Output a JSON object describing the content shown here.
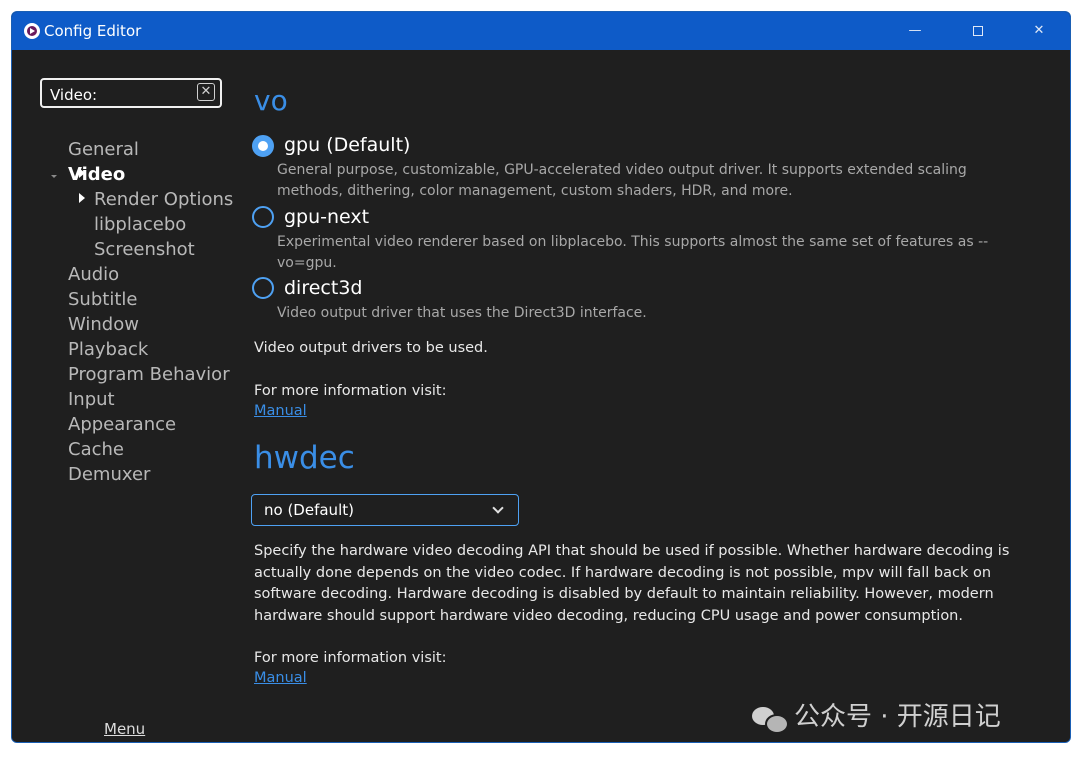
{
  "window": {
    "title": "Config Editor",
    "minimize_glyph": "—",
    "close_glyph": "✕"
  },
  "sidebar": {
    "search_value": "Video:",
    "clear_glyph": "✕",
    "items": [
      {
        "label": "General"
      },
      {
        "label": "Video"
      },
      {
        "label": "Render Options"
      },
      {
        "label": "libplacebo"
      },
      {
        "label": "Screenshot"
      },
      {
        "label": "Audio"
      },
      {
        "label": "Subtitle"
      },
      {
        "label": "Window"
      },
      {
        "label": "Playback"
      },
      {
        "label": "Program Behavior"
      },
      {
        "label": "Input"
      },
      {
        "label": "Appearance"
      },
      {
        "label": "Cache"
      },
      {
        "label": "Demuxer"
      }
    ],
    "menu_label": "Menu"
  },
  "vo": {
    "title": "vo",
    "options": [
      {
        "label": "gpu (Default)",
        "selected": true,
        "desc": "General purpose, customizable, GPU-accelerated video output driver. It supports extended scaling methods, dithering, color management, custom shaders, HDR, and more."
      },
      {
        "label": "gpu-next",
        "selected": false,
        "desc": "Experimental video renderer based on libplacebo. This supports almost the same set of features as --vo=gpu."
      },
      {
        "label": "direct3d",
        "selected": false,
        "desc": "Video output driver that uses the Direct3D interface."
      }
    ],
    "help": "Video output drivers to be used.",
    "more_info": "For more information visit:",
    "link": "Manual"
  },
  "hwdec": {
    "title": "hwdec",
    "selected_value": "no (Default)",
    "help": "Specify the hardware video decoding API that should be used if possible. Whether hardware decoding is actually done depends on the video codec. If hardware decoding is not possible, mpv will fall back on software decoding. Hardware decoding is disabled by default to maintain reliability. However, modern hardware should support hardware video decoding, reducing CPU usage and power consumption.",
    "more_info": "For more information visit:",
    "link": "Manual"
  },
  "watermark": {
    "text": "公众号 · 开源日记"
  },
  "colors": {
    "titlebar": "#0e5bc8",
    "background": "#1f1f1f",
    "accent": "#3a8ee6"
  }
}
